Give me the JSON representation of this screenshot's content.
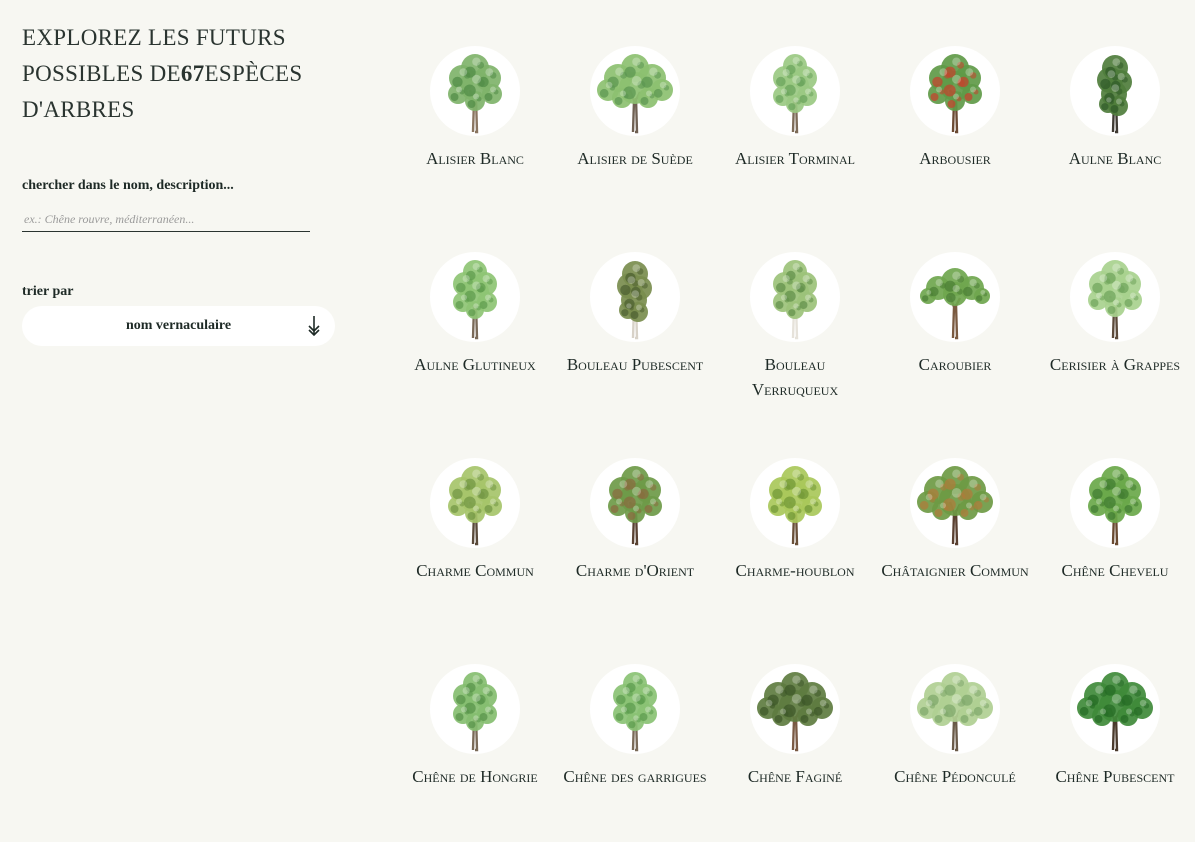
{
  "header": {
    "title_before": "EXPLOREZ LES FUTURS POSSIBLES DE",
    "count": "67",
    "title_after": "ESPÈCES D'ARBRES"
  },
  "search": {
    "label": "chercher dans le nom, description...",
    "placeholder": "ex.: Chêne rouvre, méditerranéen...",
    "value": ""
  },
  "sort": {
    "label": "trier par",
    "selected": "nom vernaculaire",
    "arrow_icon": "arrow-down-icon"
  },
  "trees": [
    {
      "name": "Alisier Blanc",
      "foliage": "#7fb36a",
      "dark": "#4f8a45",
      "shape": "round",
      "trunk": "#8a7560"
    },
    {
      "name": "Alisier de Suède",
      "foliage": "#8cc070",
      "dark": "#5a9450",
      "shape": "wide",
      "trunk": "#6f6052"
    },
    {
      "name": "Alisier Torminal",
      "foliage": "#9ac982",
      "dark": "#68a25a",
      "shape": "tall",
      "trunk": "#7d6b58"
    },
    {
      "name": "Arbousier",
      "foliage": "#5f9a48",
      "dark": "#c8402c",
      "shape": "round",
      "trunk": "#6b4a33"
    },
    {
      "name": "Aulne Blanc",
      "foliage": "#4f7d3c",
      "dark": "#2f5a28",
      "shape": "column",
      "trunk": "#3f3a33"
    },
    {
      "name": "Aulne Glutineux",
      "foliage": "#8ec474",
      "dark": "#5c9a4c",
      "shape": "tall",
      "trunk": "#7a6a58"
    },
    {
      "name": "Bouleau Pubescent",
      "foliage": "#7a8d4e",
      "dark": "#4c5e30",
      "shape": "column",
      "trunk": "#d8d2c8"
    },
    {
      "name": "Bouleau Verruqueux",
      "foliage": "#9cc27a",
      "dark": "#5f8e48",
      "shape": "tall",
      "trunk": "#e6e2da"
    },
    {
      "name": "Caroubier",
      "foliage": "#6fa64e",
      "dark": "#4a7e35",
      "shape": "umbrella",
      "trunk": "#7a5a40"
    },
    {
      "name": "Cerisier à Grappes",
      "foliage": "#a8d18e",
      "dark": "#6ea35a",
      "shape": "round",
      "trunk": "#5c4a3a"
    },
    {
      "name": "Charme Commun",
      "foliage": "#a6c46a",
      "dark": "#6f9442",
      "shape": "round",
      "trunk": "#5a4a3a"
    },
    {
      "name": "Charme d'Orient",
      "foliage": "#6e9a48",
      "dark": "#8a6a3e",
      "shape": "round",
      "trunk": "#5a4232"
    },
    {
      "name": "Charme-houblon",
      "foliage": "#a9c85a",
      "dark": "#6f9535",
      "shape": "round",
      "trunk": "#6a5038"
    },
    {
      "name": "Châtaignier Commun",
      "foliage": "#6e9a44",
      "dark": "#b07a3a",
      "shape": "wide",
      "trunk": "#5a4030"
    },
    {
      "name": "Chêne Chevelu",
      "foliage": "#6aa84a",
      "dark": "#3f7a30",
      "shape": "round",
      "trunk": "#6a4a30"
    },
    {
      "name": "Chêne de Hongrie",
      "foliage": "#86be70",
      "dark": "#569248",
      "shape": "tall",
      "trunk": "#7a6a58"
    },
    {
      "name": "Chêne des garrigues",
      "foliage": "#8ac274",
      "dark": "#5a9a4c",
      "shape": "tall",
      "trunk": "#7a6a58"
    },
    {
      "name": "Chêne Faginé",
      "foliage": "#5e7c40",
      "dark": "#3c5628",
      "shape": "wide",
      "trunk": "#7a5a44"
    },
    {
      "name": "Chêne Pédonculé",
      "foliage": "#b0cf92",
      "dark": "#7ea66a",
      "shape": "wide",
      "trunk": "#6a5a48"
    },
    {
      "name": "Chêne Pubescent",
      "foliage": "#3f8a3a",
      "dark": "#246a24",
      "shape": "wide",
      "trunk": "#4a3a2c"
    }
  ]
}
